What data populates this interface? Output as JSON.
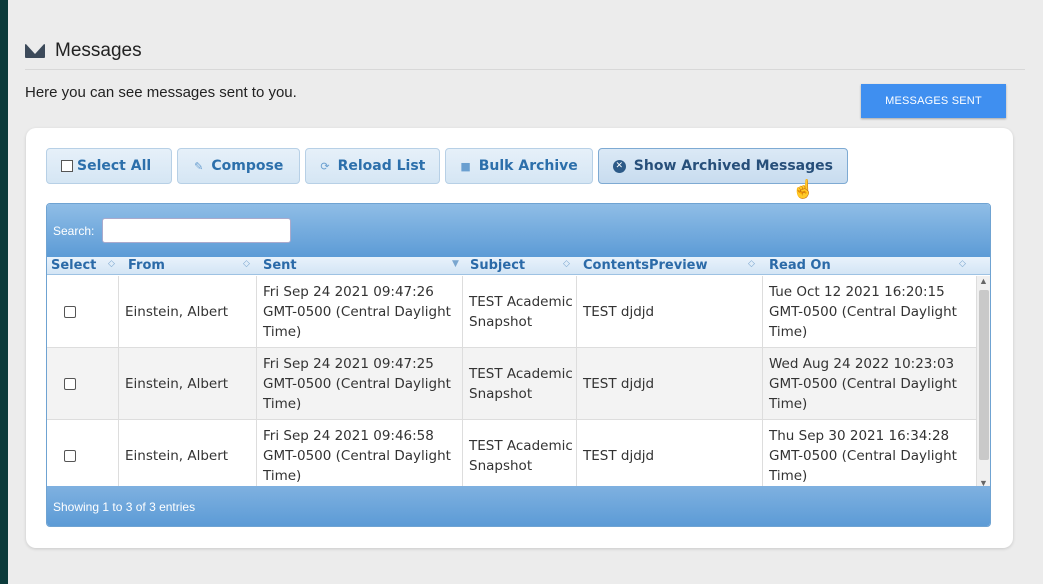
{
  "header": {
    "title": "Messages",
    "icon": "envelope-icon"
  },
  "intro": "Here you can see messages sent to you.",
  "messages_sent_button": "MESSAGES SENT",
  "toolbar": {
    "select_all": "Select All",
    "compose": "Compose",
    "reload": "Reload List",
    "bulk_archive": "Bulk Archive",
    "show_archived": "Show Archived Messages"
  },
  "grid": {
    "search_label": "Search:",
    "search_value": "",
    "columns": [
      "Select",
      "From",
      "Sent",
      "Subject",
      "ContentsPreview",
      "Read On"
    ],
    "rows": [
      {
        "from": "Einstein, Albert",
        "sent": "Fri Sep 24 2021 09:47:26 GMT-0500 (Central Daylight Time)",
        "subject": "TEST Academic Snapshot",
        "preview": "TEST djdjd",
        "read_on": "Tue Oct 12 2021 16:20:15 GMT-0500 (Central Daylight Time)"
      },
      {
        "from": "Einstein, Albert",
        "sent": "Fri Sep 24 2021 09:47:25 GMT-0500 (Central Daylight Time)",
        "subject": "TEST Academic Snapshot",
        "preview": "TEST djdjd",
        "read_on": "Wed Aug 24 2022 10:23:03 GMT-0500 (Central Daylight Time)"
      },
      {
        "from": "Einstein, Albert",
        "sent": "Fri Sep 24 2021 09:46:58 GMT-0500 (Central Daylight Time)",
        "subject": "TEST Academic Snapshot",
        "preview": "TEST djdjd",
        "read_on": "Thu Sep 30 2021 16:34:28 GMT-0500 (Central Daylight Time)"
      }
    ],
    "footer": "Showing 1 to 3 of 3 entries"
  },
  "colors": {
    "accent": "#3f8ff0",
    "grid_header": "#5c9bd6",
    "background": "#0b3a3a"
  }
}
